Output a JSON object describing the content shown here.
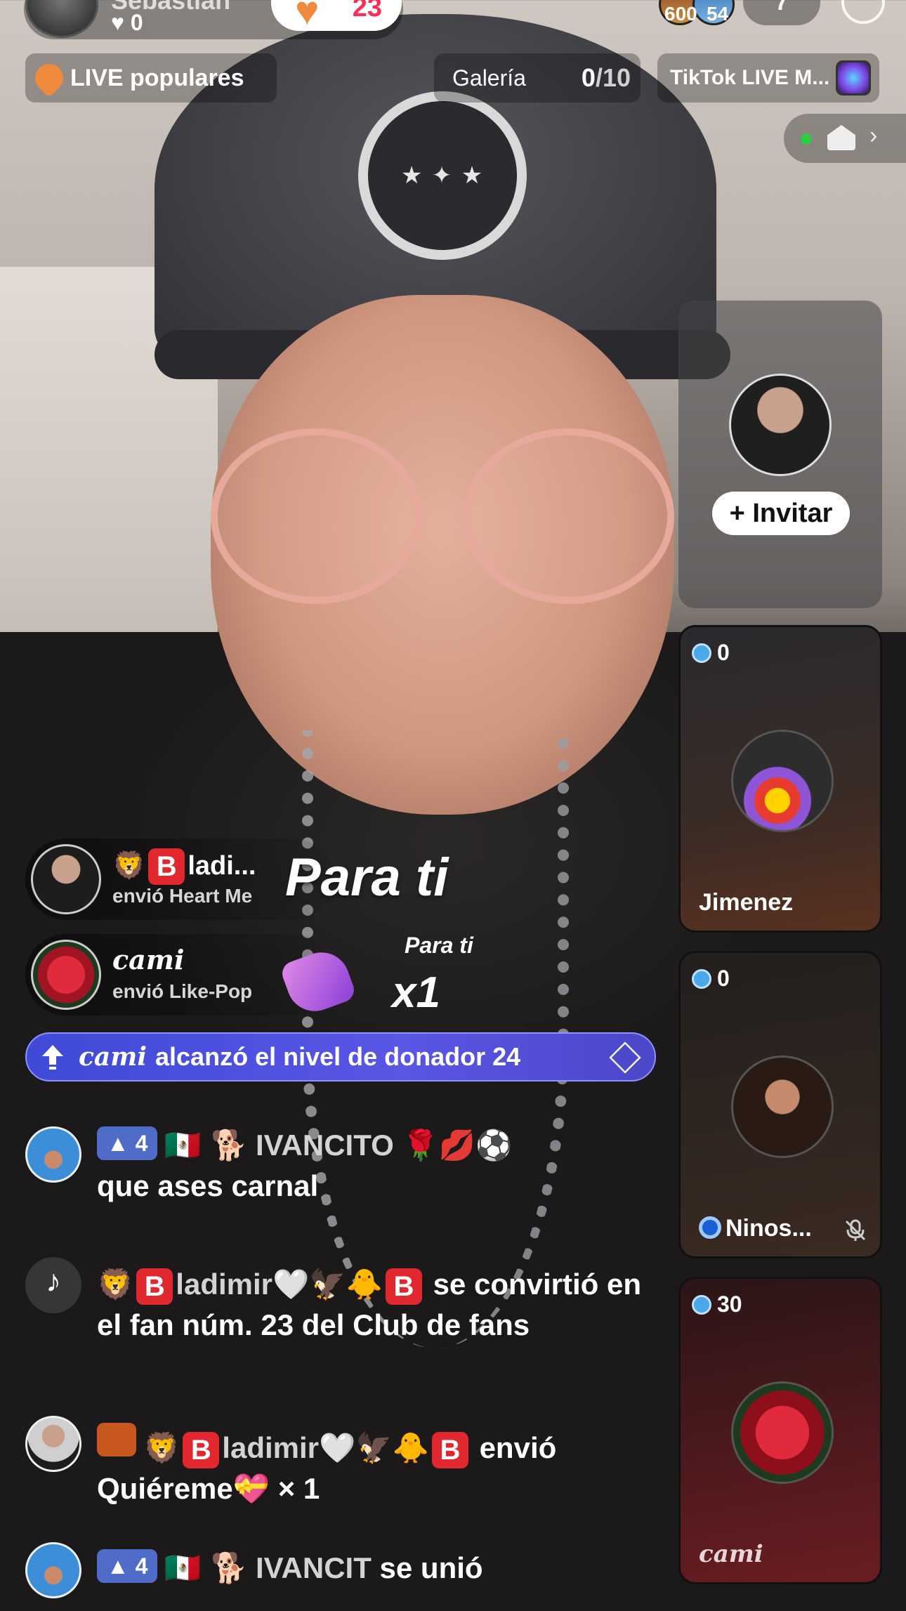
{
  "host": {
    "name": "Sebastian",
    "likes": "♥ 0",
    "follow_count": "23"
  },
  "viewers": {
    "count_a": "600",
    "count_b": "54",
    "ranking": "7"
  },
  "top_row": {
    "live_popular": "LIVE populares",
    "gallery_label": "Galería",
    "gallery_count": "0",
    "gallery_total": "/10",
    "tiktok_live_label": "TikTok LIVE M..."
  },
  "invite": {
    "button_label": "+ Invitar"
  },
  "guests": [
    {
      "score": "0",
      "name": "Jimenez"
    },
    {
      "score": "0",
      "name": "Ninos..."
    },
    {
      "score": "30",
      "name": "cami"
    }
  ],
  "gifts": [
    {
      "user": "ladi...",
      "action": "envió Heart Me"
    },
    {
      "user": "cami",
      "action": "envió Like-Pop"
    }
  ],
  "gift_overlay": {
    "para_big": "Para ti",
    "para_small": "Para ti",
    "combo": "x1"
  },
  "level_banner": {
    "user": "cami",
    "text": "alcanzó el nivel de donador 24"
  },
  "chat": [
    {
      "badge_level": "4",
      "user": "IVANCITO",
      "text": "que ases carnal"
    },
    {
      "user_part": "ladimir",
      "text": "se convirtió en el fan núm. 23 del Club de fans"
    },
    {
      "user_part": "ladimir",
      "text_a": "envió",
      "text_b": "Quiéreme",
      "text_c": "× 1"
    },
    {
      "badge_level": "4",
      "user": "IVANCIT",
      "text": "se unió"
    }
  ],
  "colors": {
    "accent_red": "#fe2c55",
    "level_banner": "#4b4fd9",
    "badge_blue": "#4e6cc8",
    "popular_orange": "#f08a3c"
  }
}
